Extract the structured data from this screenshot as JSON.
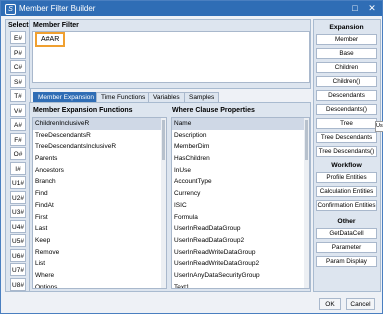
{
  "window": {
    "title": "Member Filter Builder",
    "logo": "S"
  },
  "select": {
    "header": "Select",
    "buttons": [
      "E#",
      "P#",
      "C#",
      "S#",
      "T#",
      "V#",
      "A#",
      "F#",
      "O#",
      "I#",
      "U1#",
      "U2#",
      "U3#",
      "U4#",
      "U5#",
      "U6#",
      "U7#",
      "U8#"
    ]
  },
  "member_filter": {
    "header": "Member Filter",
    "value": "A#AR"
  },
  "tabs": [
    "Member Expansion",
    "Time Functions",
    "Variables",
    "Samples"
  ],
  "functions": {
    "header": "Member Expansion Functions",
    "items": [
      "ChildrenInclusiveR",
      "TreeDescendantsR",
      "TreeDescendantsInclusiveR",
      "Parents",
      "Ancestors",
      "Branch",
      "Find",
      "FindAt",
      "First",
      "Last",
      "Keep",
      "Remove",
      "List",
      "Where",
      "Options"
    ]
  },
  "where": {
    "header": "Where Clause Properties",
    "items": [
      "Name",
      "Description",
      "MemberDim",
      "HasChildren",
      "InUse",
      "AccountType",
      "Currency",
      "ISIC",
      "Formula",
      "UserInReadDataGroup",
      "UserInReadDataGroup2",
      "UserInReadWriteDataGroup",
      "UserInReadWriteDataGroup2",
      "UserInAnyDataSecurityGroup",
      "Text1"
    ]
  },
  "expansion": {
    "header": "Expansion",
    "buttons": [
      "Member",
      "Base",
      "Children",
      "Children()",
      "Descendants",
      "Descendants()",
      "Tree",
      "Tree Descendants",
      "Tree Descendants()"
    ],
    "tooltip": "Us"
  },
  "workflow": {
    "header": "Workflow",
    "buttons": [
      "Profile Entities",
      "Calculation Entities",
      "Confirmation Entities"
    ]
  },
  "other": {
    "header": "Other",
    "buttons": [
      "GetDataCell",
      "Parameter",
      "Param Display"
    ]
  },
  "dialog": {
    "ok": "OK",
    "cancel": "Cancel"
  },
  "colors": {
    "accent": "#2f6db5",
    "highlight": "#f0a030"
  }
}
